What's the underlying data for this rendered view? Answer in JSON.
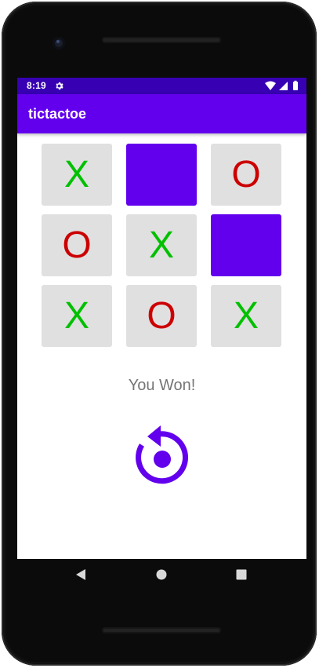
{
  "status_bar": {
    "time": "8:19",
    "icons": [
      "settings-icon",
      "wifi-icon",
      "cellular-icon",
      "battery-icon"
    ]
  },
  "app_bar": {
    "title": "tictactoe"
  },
  "board": {
    "cells": [
      {
        "mark": "X",
        "state": "x"
      },
      {
        "mark": "",
        "state": "empty"
      },
      {
        "mark": "O",
        "state": "o"
      },
      {
        "mark": "O",
        "state": "o"
      },
      {
        "mark": "X",
        "state": "x"
      },
      {
        "mark": "",
        "state": "empty"
      },
      {
        "mark": "X",
        "state": "x"
      },
      {
        "mark": "O",
        "state": "o"
      },
      {
        "mark": "X",
        "state": "x"
      }
    ]
  },
  "result": {
    "message": "You Won!"
  },
  "restart": {
    "icon": "restart-icon"
  },
  "navigation": {
    "buttons": [
      "back-icon",
      "home-icon",
      "recents-icon"
    ]
  },
  "colors": {
    "status_bar": "#3700b3",
    "app_bar": "#6200ee",
    "x_mark": "#00c000",
    "o_mark": "#cc0000",
    "empty_cell": "#6200ee",
    "cell_background": "#e0e0e0",
    "result_text": "#757575"
  }
}
